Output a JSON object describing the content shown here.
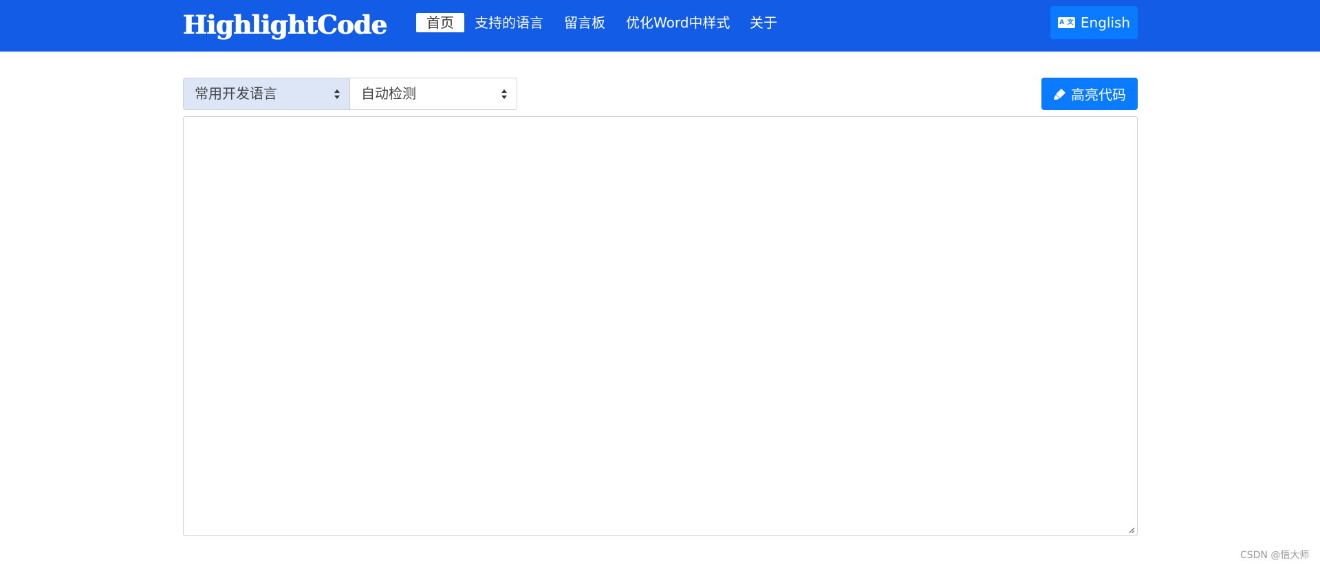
{
  "header": {
    "brand": "HighlightCode",
    "nav": {
      "home": "首页",
      "languages": "支持的语言",
      "guestbook": "留言板",
      "word_style": "优化Word中样式",
      "about": "关于"
    },
    "lang_button": {
      "label": "English",
      "icon": "translate-icon"
    },
    "colors": {
      "nav_bg": "#135ce6",
      "button_bg": "#0a7bff"
    }
  },
  "toolbar": {
    "category_select": {
      "value": "常用开发语言"
    },
    "language_select": {
      "value": "自动检测"
    },
    "highlight_button": {
      "label": "高亮代码",
      "icon": "highlighter-icon"
    }
  },
  "editor": {
    "value": ""
  },
  "watermark": "CSDN @悟大师"
}
